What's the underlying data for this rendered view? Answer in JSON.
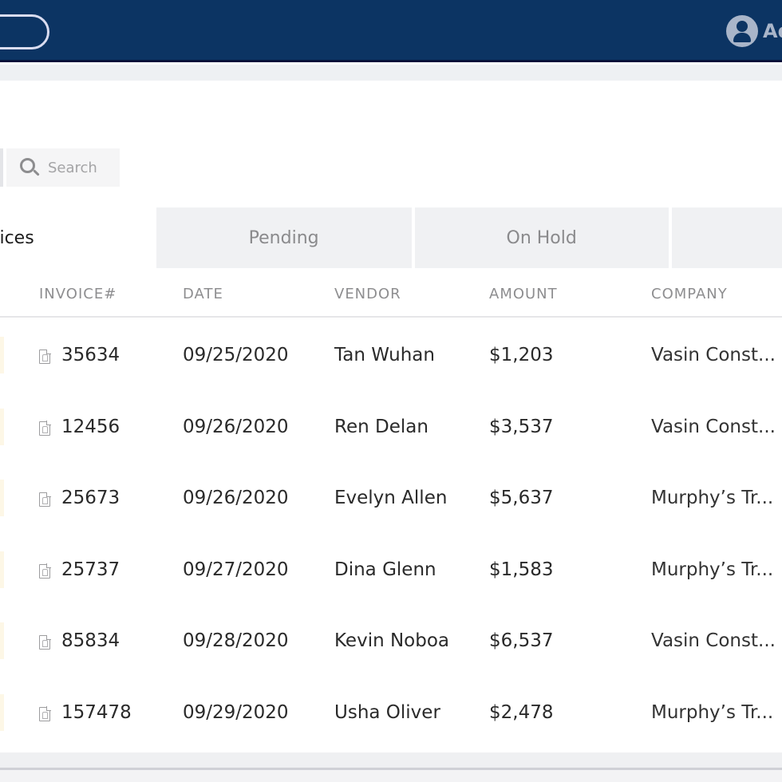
{
  "header": {
    "user_label": "Ad",
    "brand_color": "#0c3463"
  },
  "search": {
    "placeholder": "Search",
    "value": ""
  },
  "tabs": [
    {
      "label": "oices",
      "active": true
    },
    {
      "label": "Pending",
      "active": false
    },
    {
      "label": "On Hold",
      "active": false
    },
    {
      "label": "",
      "active": false
    }
  ],
  "table": {
    "columns": [
      "INVOICE#",
      "DATE",
      "VENDOR",
      "AMOUNT",
      "COMPANY"
    ],
    "rows": [
      {
        "invoice": "35634",
        "date": "09/25/2020",
        "vendor": "Tan Wuhan",
        "amount": "$1,203",
        "company": "Vasin Const..."
      },
      {
        "invoice": "12456",
        "date": "09/26/2020",
        "vendor": "Ren Delan",
        "amount": "$3,537",
        "company": "Vasin Const..."
      },
      {
        "invoice": "25673",
        "date": "09/26/2020",
        "vendor": "Evelyn Allen",
        "amount": "$5,637",
        "company": "Murphy’s Tr..."
      },
      {
        "invoice": "25737",
        "date": "09/27/2020",
        "vendor": "Dina Glenn",
        "amount": "$1,583",
        "company": "Murphy’s Tr..."
      },
      {
        "invoice": "85834",
        "date": "09/28/2020",
        "vendor": "Kevin Noboa",
        "amount": "$6,537",
        "company": "Vasin Const..."
      },
      {
        "invoice": "157478",
        "date": "09/29/2020",
        "vendor": "Usha Oliver",
        "amount": "$2,478",
        "company": "Murphy’s Tr..."
      }
    ]
  }
}
